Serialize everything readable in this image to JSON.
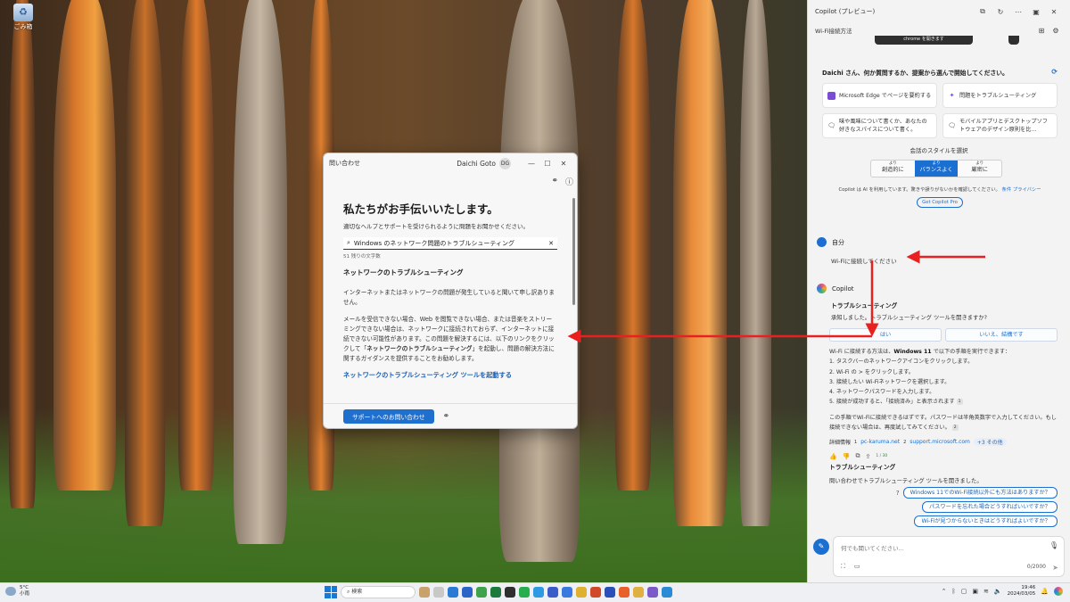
{
  "desktop": {
    "recycle_label": "ごみ箱"
  },
  "help_window": {
    "title": "問い合わせ",
    "user_name": "Daichi Goto",
    "user_initials": "DG",
    "heading": "私たちがお手伝いいたします。",
    "subheading": "適切なヘルプとサポートを受けられるように問題をお聞かせください。",
    "search_value": "Windows のネットワーク問題のトラブルシューティング",
    "char_count": "51 残りの文字数",
    "section_title": "ネットワークのトラブルシューティング",
    "para1": "インターネットまたはネットワークの問題が発生していると聞いて申し訳ありません。",
    "para2_a": "メールを受信できない場合、Web を閲覧できない場合、または音楽をストリーミングできない場合は、ネットワークに接続されておらず、インターネットに接続できない可能性があります。この問題を解決するには、以下のリンクをクリックして「",
    "para2_b": "ネットワークのトラブルシューティング",
    "para2_c": "」を起動し、問題の解決方法に関するガイダンスを提供することをお勧めします。",
    "link": "ネットワークのトラブルシューティング ツールを起動する",
    "contact_button": "サポートへのお問い合わせ"
  },
  "copilot": {
    "title": "Copilot (プレビュー)",
    "conversation_title": "Wi-Fi接続方法",
    "peek_text": "chrome を開きます",
    "greeting": "Daichi さん、何か質問するか、提案から選んで開始してください。",
    "suggestions": [
      {
        "text": "Microsoft Edge でページを要約する",
        "icon_color": "#7b4bd6"
      },
      {
        "text": "問題をトラブルシューティング",
        "icon_color": "#7b4bd6"
      },
      {
        "text": "味や風味について書くか、あなたの好きなスパイスについて書く。",
        "icon_color": "#444444"
      },
      {
        "text": "モバイルアプリとデスクトップソフトウェアのデザイン原則を比...",
        "icon_color": "#444444"
      }
    ],
    "style_label": "会話のスタイルを選択",
    "styles": [
      {
        "top": "より",
        "label": "創造的に",
        "active": false
      },
      {
        "top": "より",
        "label": "バランスよく",
        "active": true
      },
      {
        "top": "より",
        "label": "厳密に",
        "active": false
      }
    ],
    "disclaimer": "Copilot は AI を利用しています。驚きや誤りがないかを確認してください。",
    "terms": "条件",
    "privacy": "プライバシー",
    "pro_button": "Get Copilot Pro",
    "user_label": "自分",
    "user_message": "Wi-Fiに接続してください",
    "ai_label": "Copilot",
    "ai_heading": "トラブルシューティング",
    "ai_question": "承知しました。トラブルシューティング ツールを開きますか?",
    "yes": "はい",
    "no": "いいえ、結構です",
    "answer_intro_a": "Wi-Fi に接続する方法は、",
    "answer_intro_b": "Windows 11",
    "answer_intro_c": " で以下の手順を実行できます：",
    "steps": [
      "1. タスクバーのネットワークアイコンをクリックします。",
      "2. Wi-Fi の > をクリックします。",
      "3. 接続したい Wi-Fiネットワークを選択します。",
      "4. ネットワークパスワードを入力します。",
      "5. 接続が成功すると、「接続済み」と表示されます"
    ],
    "answer_outro": "この手順でWi-Fiに接続できるはずです。パスワードは半角英数字で入力してください。もし接続できない場合は、再度試してみてください。",
    "refs_label": "詳細情報",
    "refs": [
      "pc-karuma.net",
      "support.microsoft.com"
    ],
    "refs_more": "+3 その他",
    "page_indicator": "1 / 30",
    "ts_title": "トラブルシューティング",
    "ts_text": "問い合わせでトラブルシューティング ツールを開きました。",
    "followups": [
      "Windows 11でのWi-Fi接続以外にも方法はありますか？",
      "パスワードを忘れた場合どうすればいいですか？",
      "Wi-Fiが見つからないときはどうすればよいですか？"
    ],
    "input_placeholder": "何でも聞いてください...",
    "char_limit": "0/2000"
  },
  "taskbar": {
    "temp": "5°C",
    "weather": "小雨",
    "search_placeholder": "検索",
    "time": "19:46",
    "date": "2024/03/05"
  }
}
